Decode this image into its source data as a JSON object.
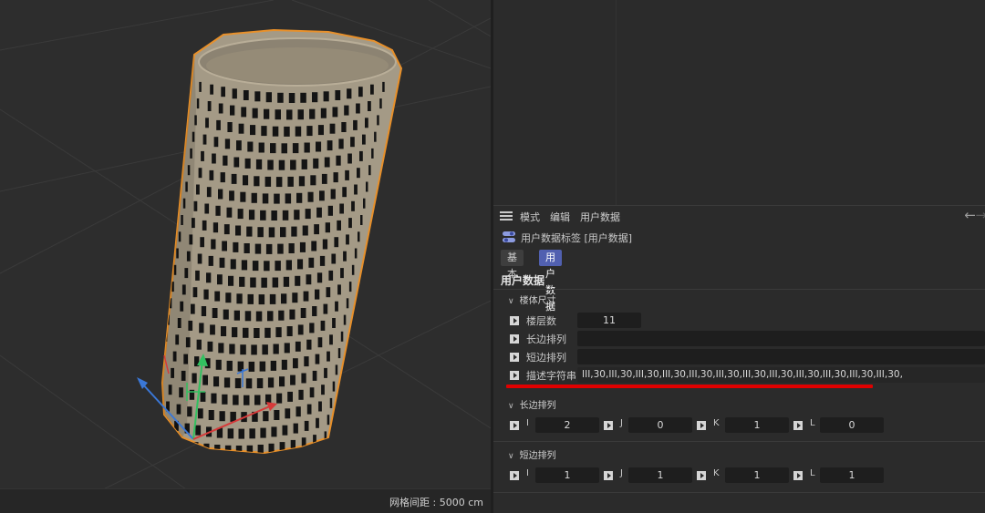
{
  "viewport": {
    "grid_spacing_label": "网格间距 : 5000 cm"
  },
  "attribute_manager": {
    "menu": [
      "模式",
      "编辑",
      "用户数据"
    ],
    "tag_title": "用户数据标签 [用户数据]",
    "tabs": [
      {
        "label": "基本",
        "active": false
      },
      {
        "label": "用户数据",
        "active": true
      }
    ],
    "section_title": "用户数据",
    "groups": [
      {
        "label": "楼体尺寸",
        "params": [
          {
            "label": "楼层数",
            "value": "11"
          },
          {
            "label": "长边排列",
            "value": ""
          },
          {
            "label": "短边排列",
            "value": ""
          },
          {
            "label": "描述字符串",
            "value": "III,30,III,30,III,30,III,30,III,30,III,30,III,30,III,30,III,30,III,30,III,30,III,30,"
          }
        ]
      },
      {
        "label": "长边排列",
        "params": [
          {
            "label": "I",
            "value": "2"
          },
          {
            "label": "J",
            "value": "0"
          },
          {
            "label": "K",
            "value": "1"
          },
          {
            "label": "L",
            "value": "0"
          }
        ]
      },
      {
        "label": "短边排列",
        "params": [
          {
            "label": "I",
            "value": "1"
          },
          {
            "label": "J",
            "value": "1"
          },
          {
            "label": "K",
            "value": "1"
          },
          {
            "label": "L",
            "value": "1"
          }
        ]
      }
    ]
  },
  "colors": {
    "active_tab": "#5160b0",
    "highlight_underline": "#e00000",
    "selection_outline": "#e8902a",
    "building_wall": "#a49a86"
  },
  "icons": [
    "hamburger-menu-icon",
    "user-data-tag-icon",
    "keyframe-icon",
    "arrow-left-icon",
    "arrow-right-icon",
    "chevron-down-icon"
  ]
}
